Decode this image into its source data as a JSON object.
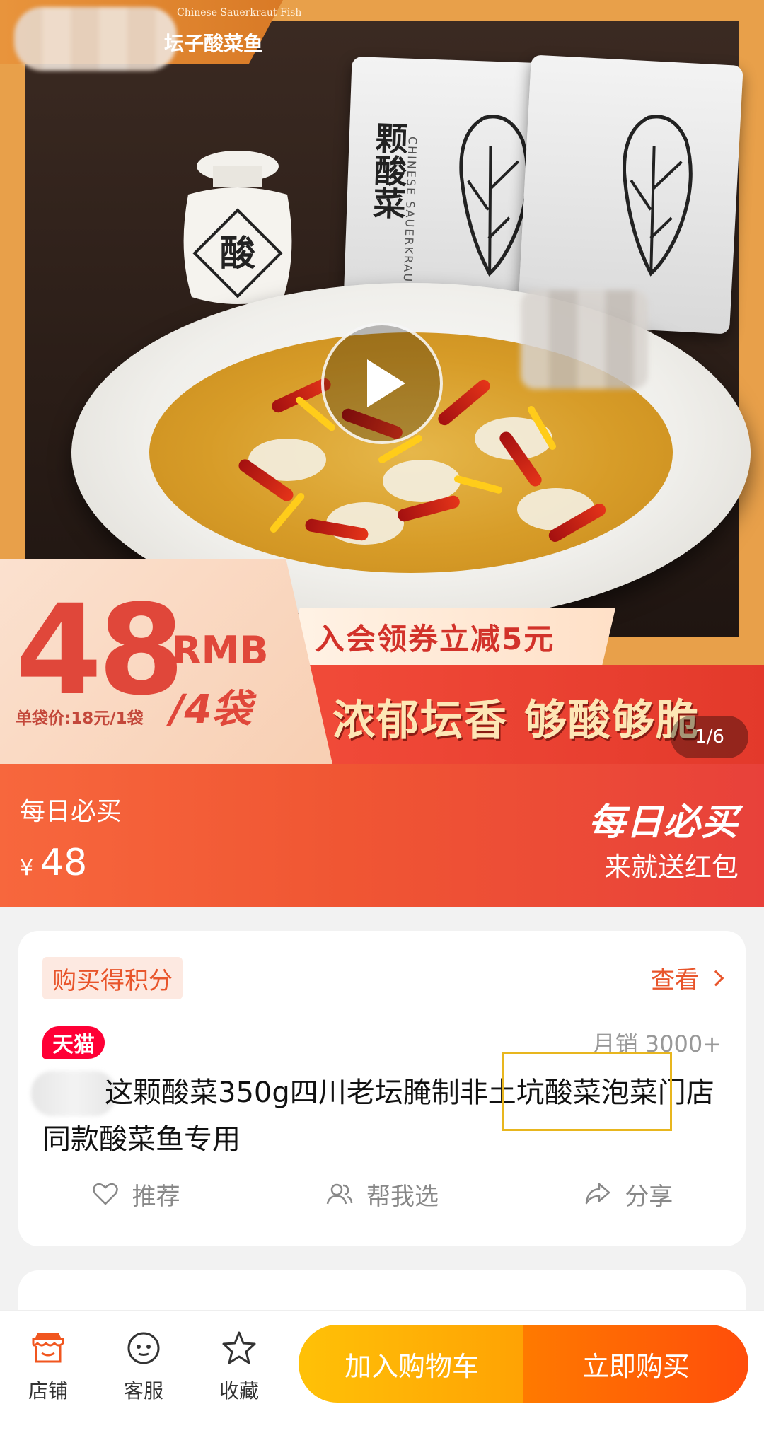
{
  "hero": {
    "brand_subtitle": "Chinese Sauerkraut Fish",
    "brand_title": "坛子酸菜鱼",
    "pack_text": "颗酸菜",
    "pack_en": "CHINESE SAUERKRAUT",
    "jar_label": "酸",
    "price_value": "48",
    "price_unit": "RMB",
    "price_bags": "/4袋",
    "price_single": "单袋价:18元/1袋",
    "coupon": "入会领券立减5元",
    "slogan": "浓郁坛香 够酸够脆",
    "page_indicator": "1/6"
  },
  "price_banner": {
    "label": "每日必买",
    "currency": "¥",
    "price": "48",
    "right_title": "每日必买",
    "right_sub": "来就送红包"
  },
  "product": {
    "points_tag": "购买得积分",
    "view_link": "查看",
    "tmall_badge": "天猫",
    "monthly_sales": "月销 3000+",
    "title": "这颗酸菜350g四川老坛腌制非土坑酸菜泡菜门店同款酸菜鱼专用",
    "actions": [
      {
        "label": "推荐",
        "icon": "heart-icon"
      },
      {
        "label": "帮我选",
        "icon": "people-icon"
      },
      {
        "label": "分享",
        "icon": "share-icon"
      }
    ]
  },
  "bottom_bar": {
    "tabs": [
      {
        "label": "店铺",
        "icon": "store-icon"
      },
      {
        "label": "客服",
        "icon": "customer-service-icon"
      },
      {
        "label": "收藏",
        "icon": "star-icon"
      }
    ],
    "add_to_cart": "加入购物车",
    "buy_now": "立即购买"
  },
  "colors": {
    "accent": "#f05633",
    "tmall_red": "#ff0036",
    "cart_yellow": "#ffb300",
    "buy_orange": "#ff5a0a"
  }
}
